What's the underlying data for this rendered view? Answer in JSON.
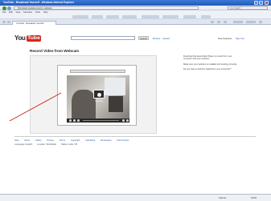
{
  "window": {
    "title": "YouTube - Broadcast Yourself - Windows Internet Explorer"
  },
  "addressbar": {
    "url": "http://www.youtube.com/my_webcam",
    "search_placeholder": "Live Search"
  },
  "menubar": {
    "items": [
      "File",
      "Edit",
      "View",
      "Favorites",
      "Tools",
      "Help"
    ]
  },
  "tab": {
    "label": "YouTube - Broadcast Yourself"
  },
  "header": {
    "logo_you": "You",
    "logo_tube": "Tube",
    "search_button": "Search",
    "browse": "Browse",
    "upload": "Upload",
    "new_feature": "New Features",
    "signout": "Sign Out"
  },
  "main": {
    "heading": "Record Video from Webcam",
    "camera_label": "Camera"
  },
  "sidebar": {
    "paragraphs": [
      "Download the latest Flash Player to record from your computer with your webcam.",
      "Make sure your webcam is installed and working correctly.",
      "Do you have a webcam attached to your computer?"
    ]
  },
  "footer": {
    "links": [
      "Help",
      "About",
      "Safety",
      "Privacy",
      "Terms",
      "Copyright",
      "Uploading",
      "Developers",
      "Partnerships"
    ],
    "language_label": "Language: English",
    "location_label": "Location: Worldwide",
    "safety_label": "Safety mode: Off"
  },
  "statusbar": {
    "zone": "Internet",
    "zoom": "100%"
  },
  "colors": {
    "brand_red": "#d0271d",
    "link_blue": "#2a63b8",
    "titlebar_blue": "#2358b8"
  }
}
